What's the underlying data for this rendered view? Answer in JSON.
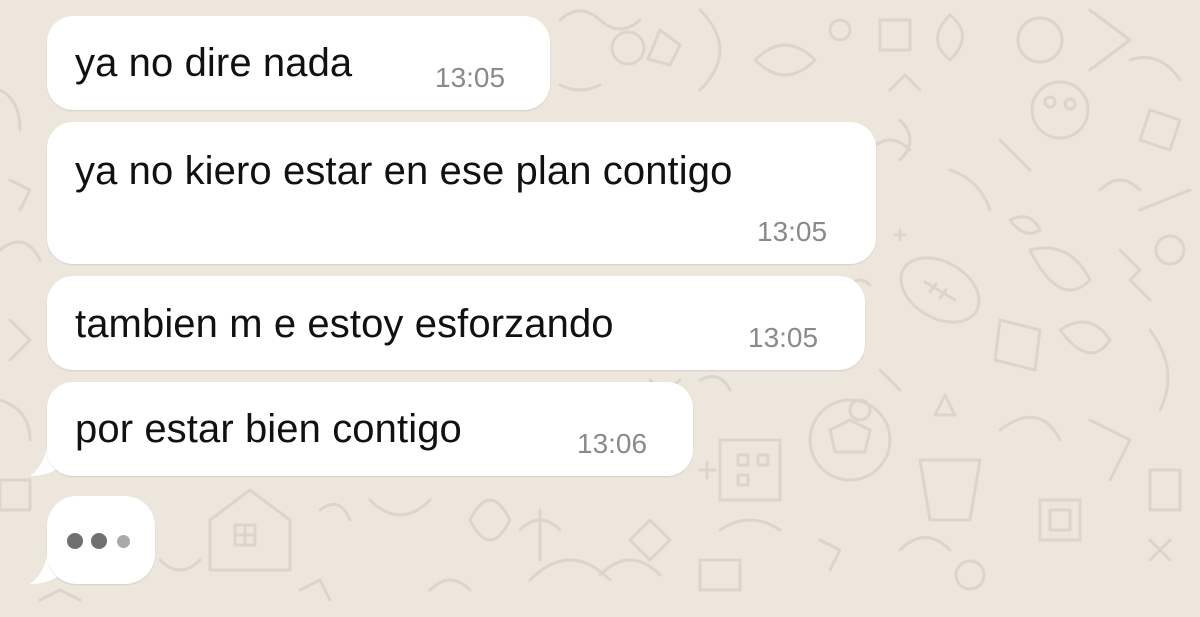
{
  "conversation": {
    "messages": [
      {
        "text": "ya no dire nada",
        "time": "13:05"
      },
      {
        "text": "ya no kiero estar en ese plan contigo",
        "time": "13:05"
      },
      {
        "text": "tambien m e estoy esforzando",
        "time": "13:05"
      },
      {
        "text": "por estar bien contigo",
        "time": "13:06"
      }
    ],
    "typing_indicator": {
      "dot_colors": [
        "#6f6f6f",
        "#6f6f6f",
        "#a9a9a9"
      ]
    }
  },
  "colors": {
    "wallpaper": "#ece6dd",
    "doodles": "#dcd5cb",
    "bubble": "#ffffff",
    "message_text": "#111111",
    "timestamp": "#8a8a8a"
  }
}
